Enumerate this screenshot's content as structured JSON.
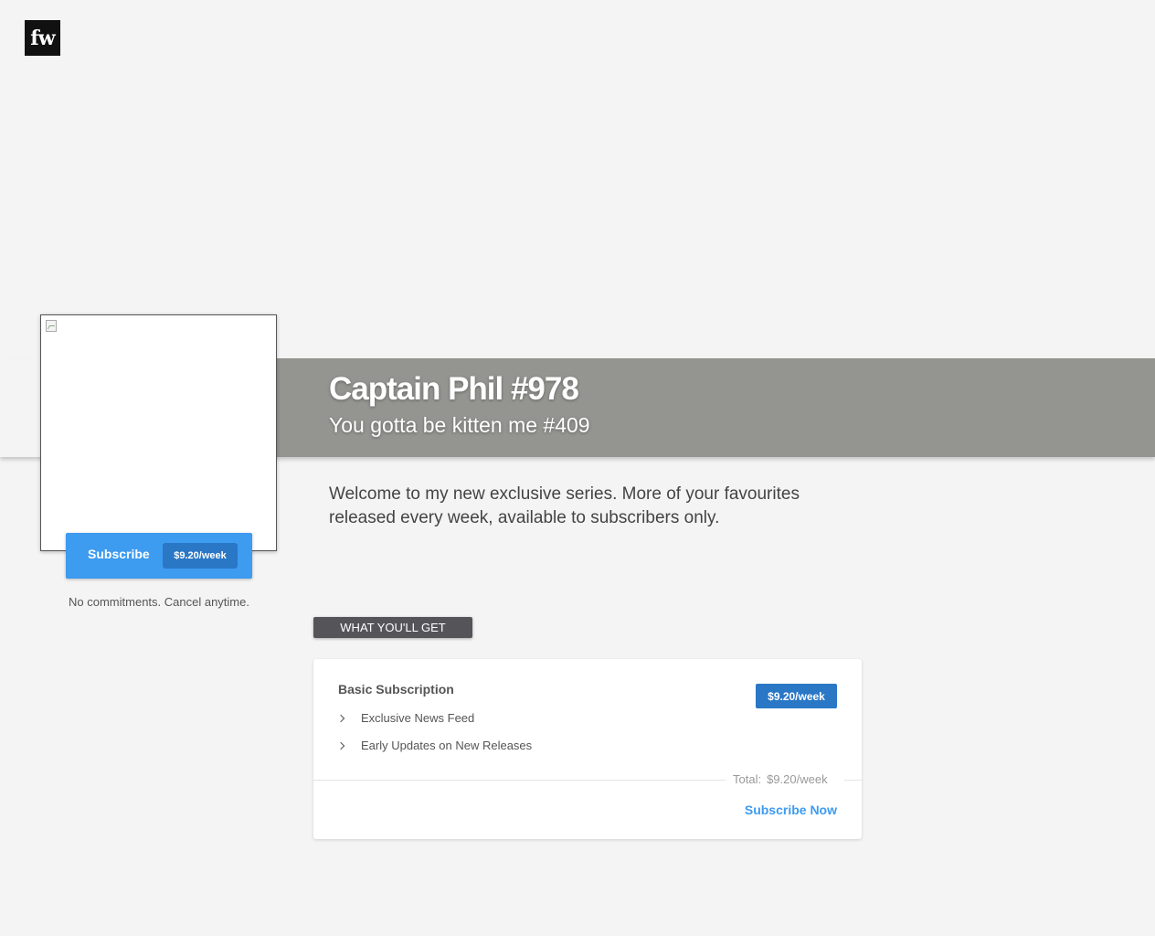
{
  "header": {
    "logo_text": "fw"
  },
  "hero": {
    "title": "Captain Phil #978",
    "subtitle": "You gotta be kitten me #409",
    "band_color": "#949490"
  },
  "sidebar": {
    "cover_image": "broken-image-icon",
    "subscribe_button": {
      "label": "Subscribe",
      "price": "$9.20/week"
    },
    "note": "No commitments. Cancel anytime."
  },
  "main": {
    "description": "Welcome to my new exclusive series. More of your favourites released every week, available to subscribers only.",
    "section_label": "WHAT YOU'LL GET",
    "plan": {
      "name": "Basic Subscription",
      "price_badge": "$9.20/week",
      "features": [
        "Exclusive News Feed",
        "Early Updates on New Releases"
      ],
      "total_label": "Total:",
      "total_value": "$9.20/week",
      "cta": "Subscribe Now"
    }
  },
  "colors": {
    "accent": "#3d9bf0",
    "accent_dark": "#2a77c6",
    "background": "#f4f4f4"
  }
}
